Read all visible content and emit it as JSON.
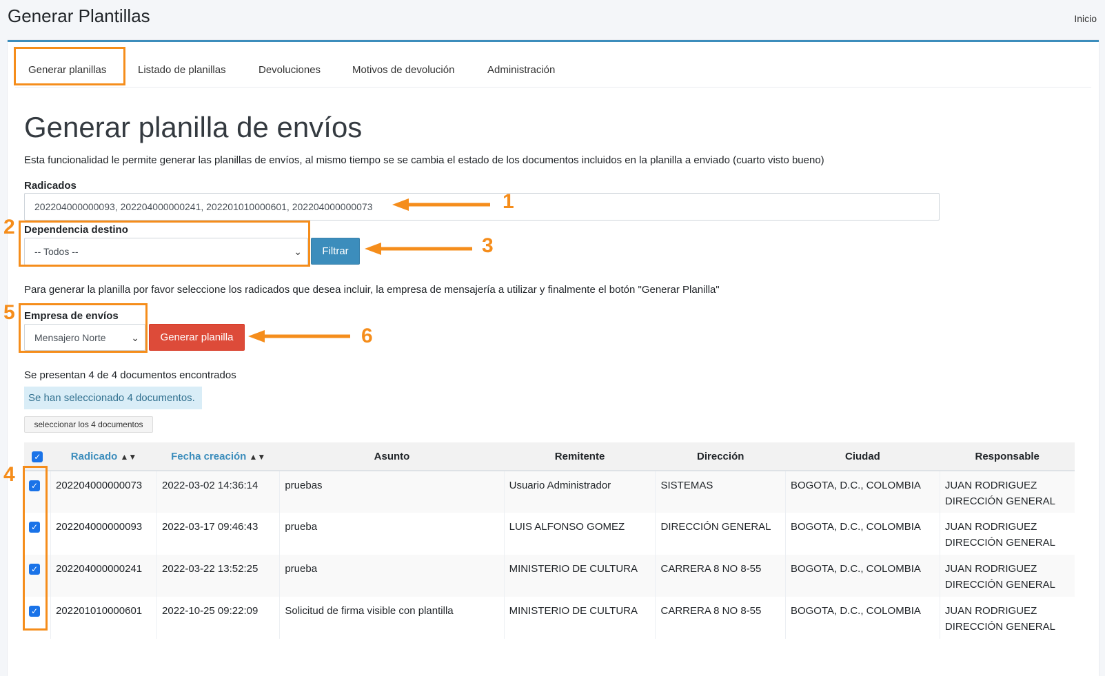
{
  "header": {
    "page_title": "Generar Plantillas",
    "breadcrumb": "Inicio"
  },
  "tabs": [
    {
      "label": "Generar planillas"
    },
    {
      "label": "Listado de planillas"
    },
    {
      "label": "Devoluciones"
    },
    {
      "label": "Motivos de devolución"
    },
    {
      "label": "Administración"
    }
  ],
  "main": {
    "title": "Generar planilla de envíos",
    "description": "Esta funcionalidad le permite generar las planillas de envíos, al mismo tiempo se se cambia el estado de los documentos incluidos en la planilla a enviado (cuarto visto bueno)",
    "radicados_label": "Radicados",
    "radicados_value": "202204000000093, 202204000000241, 202201010000601, 202204000000073",
    "dependencia_label": "Dependencia destino",
    "dependencia_value": "-- Todos --",
    "filter_button": "Filtrar",
    "instructions": "Para generar la planilla por favor seleccione los radicados que desea incluir, la empresa de mensajería a utilizar y finalmente el botón \"Generar Planilla\"",
    "empresa_label": "Empresa de envíos",
    "empresa_value": "Mensajero Norte",
    "generate_button": "Generar planilla",
    "results_text": "Se presentan 4 de 4 documentos encontrados",
    "selected_alert": "Se han seleccionado 4 documentos.",
    "select_all_button": "seleccionar los 4 documentos"
  },
  "table": {
    "columns": {
      "radicado": "Radicado",
      "fecha": "Fecha creación",
      "asunto": "Asunto",
      "remitente": "Remitente",
      "direccion": "Dirección",
      "ciudad": "Ciudad",
      "responsable": "Responsable"
    },
    "rows": [
      {
        "radicado": "202204000000073",
        "fecha": "2022-03-02 14:36:14",
        "asunto": "pruebas",
        "remitente": "Usuario Administrador",
        "direccion": "SISTEMAS",
        "ciudad": "BOGOTA, D.C., COLOMBIA",
        "responsable_name": "JUAN RODRIGUEZ",
        "responsable_dep": "DIRECCIÓN GENERAL"
      },
      {
        "radicado": "202204000000093",
        "fecha": "2022-03-17 09:46:43",
        "asunto": "prueba",
        "remitente": "LUIS ALFONSO GOMEZ",
        "direccion": "DIRECCIÓN GENERAL",
        "ciudad": "BOGOTA, D.C., COLOMBIA",
        "responsable_name": "JUAN RODRIGUEZ",
        "responsable_dep": "DIRECCIÓN GENERAL"
      },
      {
        "radicado": "202204000000241",
        "fecha": "2022-03-22 13:52:25",
        "asunto": "prueba",
        "remitente": "MINISTERIO DE CULTURA",
        "direccion": "CARRERA 8 NO 8-55",
        "ciudad": "BOGOTA, D.C., COLOMBIA",
        "responsable_name": "JUAN RODRIGUEZ",
        "responsable_dep": "DIRECCIÓN GENERAL"
      },
      {
        "radicado": "202201010000601",
        "fecha": "2022-10-25 09:22:09",
        "asunto": "Solicitud de firma visible con plantilla",
        "remitente": "MINISTERIO DE CULTURA",
        "direccion": "CARRERA 8 NO 8-55",
        "ciudad": "BOGOTA, D.C., COLOMBIA",
        "responsable_name": "JUAN RODRIGUEZ",
        "responsable_dep": "DIRECCIÓN GENERAL"
      }
    ]
  },
  "annotations": {
    "n1": "1",
    "n2": "2",
    "n3": "3",
    "n4": "4",
    "n5": "5",
    "n6": "6",
    "color": "#f58d1b"
  },
  "colors": {
    "primary": "#3c8dbc",
    "danger": "#dd4b39",
    "info_bg": "#d9edf7",
    "checkbox": "#1a73e8"
  }
}
